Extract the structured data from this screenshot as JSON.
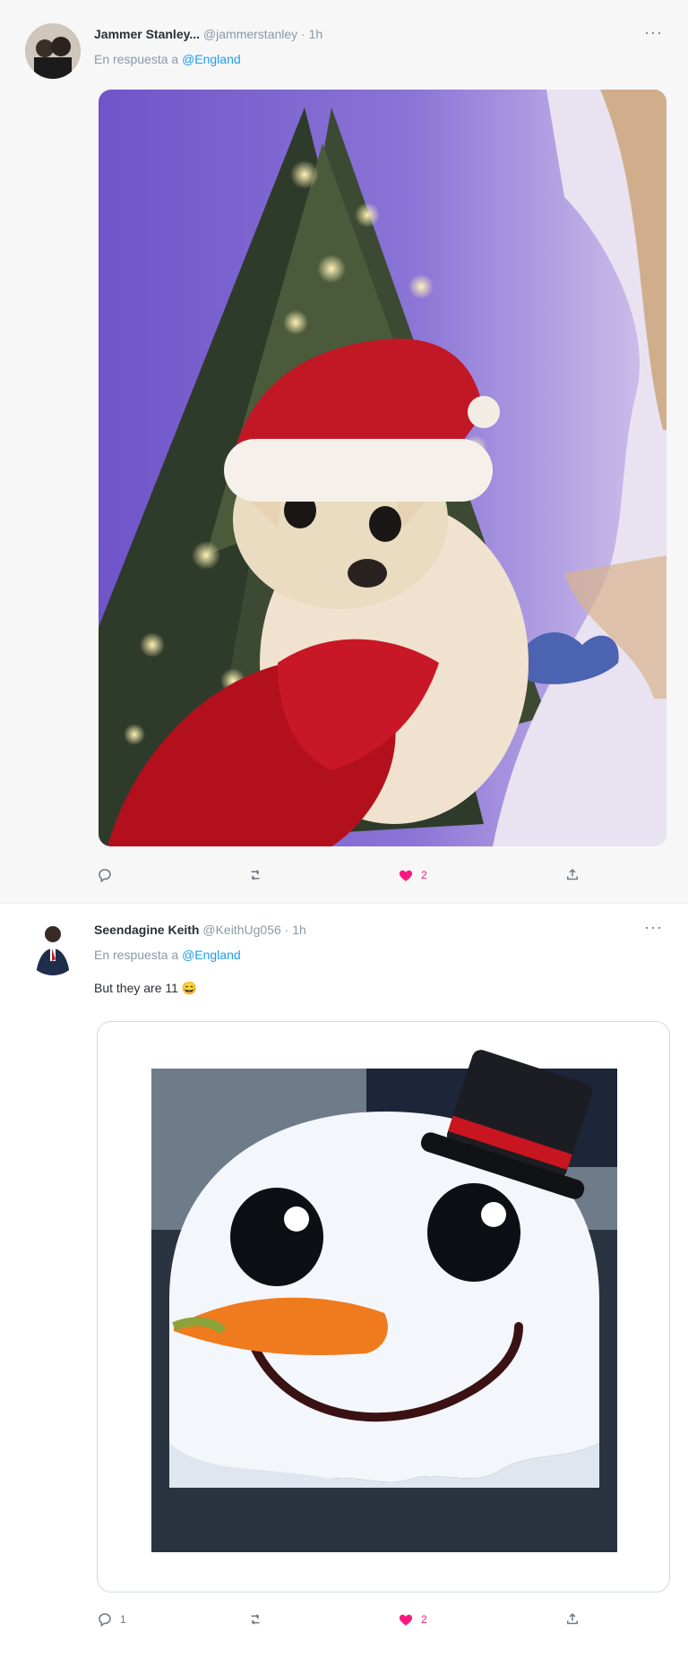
{
  "tweets": [
    {
      "author_name": "Jammer Stanley...",
      "handle": "@jammerstanley",
      "time": "· 1h",
      "reply_prefix": "En respuesta a",
      "reply_to": "@England",
      "text": "",
      "media_icon": "photo",
      "actions": {
        "reply_count": "",
        "retweet_count": "",
        "like_count": "2",
        "share_icon": "share-icon"
      }
    },
    {
      "author_name": "Seendagine Keith",
      "handle": "@KeithUg056",
      "time": "· 1h",
      "reply_prefix": "En respuesta a",
      "reply_to": "@England",
      "text": "But they are 11",
      "emoji": "😄",
      "media_icon": "gif",
      "actions": {
        "reply_count": "1",
        "retweet_count": "",
        "like_count": "2",
        "share_icon": "share-icon"
      }
    }
  ],
  "colors": {
    "accent": "#1d9bf0",
    "like": "#f91880",
    "muted": "#8b98a5"
  }
}
